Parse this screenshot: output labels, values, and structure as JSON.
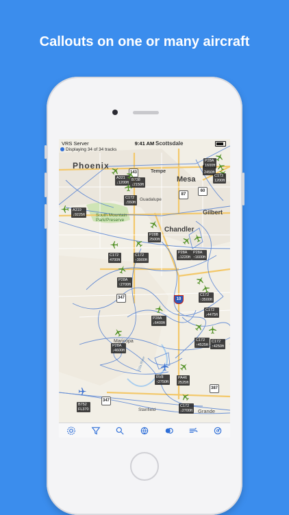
{
  "headline": "Callouts on one or many aircraft",
  "status_bar": {
    "carrier": "VRS Server",
    "time": "9:41 AM",
    "battery_pct": 100
  },
  "tracking_info": "Displaying 34 of 34 tracks",
  "map_labels": {
    "scottsdale": "Scottsdale",
    "phoenix": "Phoenix",
    "tempe": "Tempe",
    "mesa": "Mesa",
    "guadalupe": "Guadalupe",
    "gilbert": "Gilbert",
    "chandler": "Chandler",
    "maricopa": "Maricopa",
    "park": "South Mountain Park/Preserve",
    "grande": "Grande",
    "stanfield": "Stanfield",
    "gila": "Gila River"
  },
  "road_shields": [
    "143",
    "87",
    "60",
    "10",
    "347",
    "347",
    "387"
  ],
  "aircraft_callouts": [
    {
      "id": "a1",
      "text": "A319\n↓9225ft"
    },
    {
      "id": "a2",
      "text": "A321\n↓1200ft"
    },
    {
      "id": "a3",
      "text": "B738\n↓2150ft"
    },
    {
      "id": "a4",
      "text": "C172\n↓550ft"
    },
    {
      "id": "a5",
      "text": "P28B\n2500ft"
    },
    {
      "id": "a6",
      "text": "C172\n4700ft"
    },
    {
      "id": "a7",
      "text": "C172\n↑3900ft"
    },
    {
      "id": "a8",
      "text": "P28A\n↑2700ft"
    },
    {
      "id": "a9",
      "text": "P28A\n↓1220ft"
    },
    {
      "id": "a10",
      "text": "P28A\n↑1600ft"
    },
    {
      "id": "a11",
      "text": "P28A\n↓6400ft"
    },
    {
      "id": "a12",
      "text": "P28A\n↓4600ft"
    },
    {
      "id": "a13",
      "text": "C172\n↑3500ft"
    },
    {
      "id": "a14",
      "text": "C172\n↓4475ft"
    },
    {
      "id": "a15",
      "text": "C172\n↑4525ft"
    },
    {
      "id": "a16",
      "text": "C172\n↑4250ft"
    },
    {
      "id": "a17",
      "text": "RV8\n↑2750ft"
    },
    {
      "id": "a18",
      "text": "PA46\n2525ft"
    },
    {
      "id": "a19",
      "text": "C172\n↓2700ft"
    },
    {
      "id": "a20",
      "text": "B752\nFL370"
    },
    {
      "id": "a21",
      "text": "DA40\n2450ft"
    },
    {
      "id": "a22",
      "text": "P28A\n1600ft"
    },
    {
      "id": "a23",
      "text": "C172\n1200ft"
    }
  ],
  "toolbar": [
    "settings-icon",
    "filter-icon",
    "search-icon",
    "globe-icon",
    "layers-icon",
    "weather-icon",
    "radar-icon"
  ],
  "colors": {
    "background": "#3b8ded",
    "plane": "#4f8f22",
    "track": "#3a6fd0",
    "callout_bg": "#2d2d2d"
  }
}
